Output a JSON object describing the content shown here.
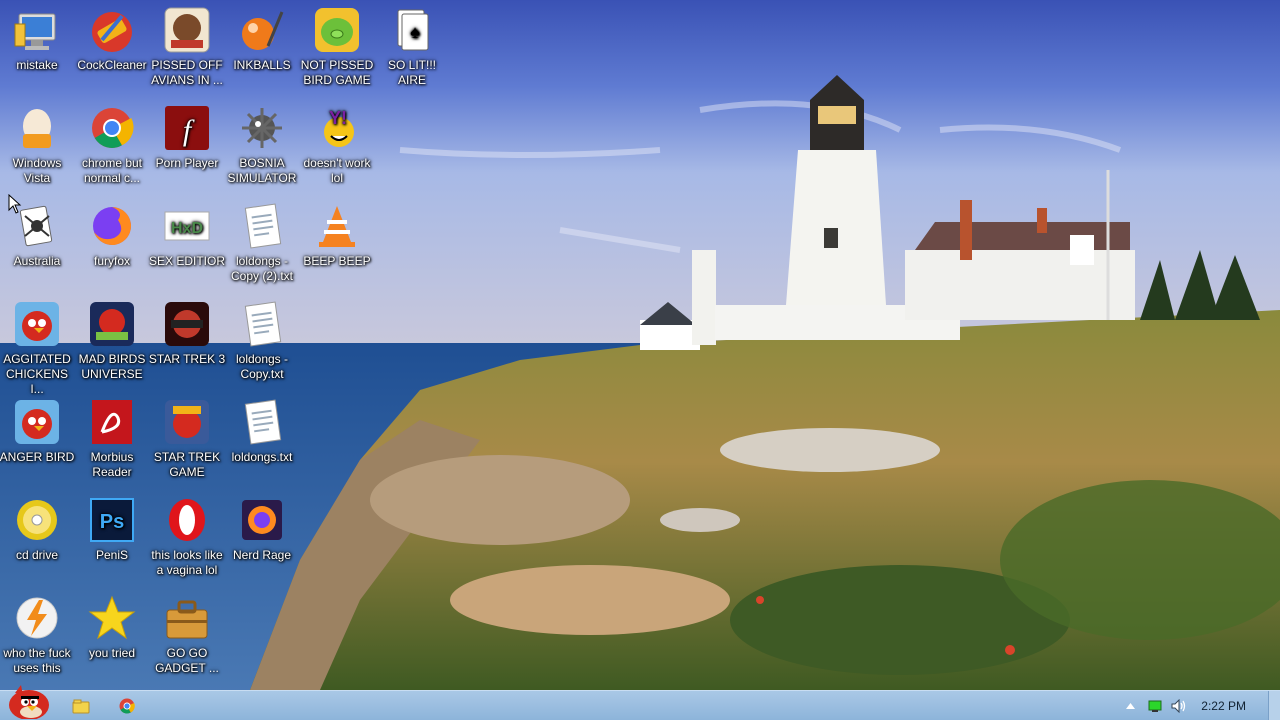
{
  "desktop": {
    "icons": [
      {
        "label": "mistake",
        "icon": "computer-icon"
      },
      {
        "label": "CockCleaner",
        "icon": "ccleaner-icon"
      },
      {
        "label": "PISSED OFF AVIANS IN ...",
        "icon": "angry-birds-seasons-icon"
      },
      {
        "label": "INKBALLS",
        "icon": "inkball-icon"
      },
      {
        "label": "NOT PISSED BIRD GAME",
        "icon": "bad-piggies-icon"
      },
      {
        "label": "SO LIT!!! AIRE",
        "icon": "solitaire-icon"
      },
      {
        "label": "Windows Vista",
        "icon": "egg-icon"
      },
      {
        "label": "chrome but normal c...",
        "icon": "chrome-icon"
      },
      {
        "label": "Porn Player",
        "icon": "flash-player-icon"
      },
      {
        "label": "BOSNIA SIMULATOR",
        "icon": "minesweeper-icon"
      },
      {
        "label": "doesn't work lol",
        "icon": "yahoo-messenger-icon"
      },
      {
        "label": "Australia",
        "icon": "spider-solitaire-icon"
      },
      {
        "label": "furyfox",
        "icon": "firefox-icon"
      },
      {
        "label": "SEX EDITIOR",
        "icon": "hxd-editor-icon"
      },
      {
        "label": "loldongs - Copy (2).txt",
        "icon": "text-file-icon"
      },
      {
        "label": "BEEP BEEP",
        "icon": "vlc-icon"
      },
      {
        "label": "AGGITATED CHICKENS I...",
        "icon": "angry-birds-icon"
      },
      {
        "label": "MAD BIRDS UNIVERSE",
        "icon": "angry-birds-space-icon"
      },
      {
        "label": "STAR TREK 3",
        "icon": "angry-birds-star-wars-2-icon"
      },
      {
        "label": "loldongs - Copy.txt",
        "icon": "text-file-icon"
      },
      {
        "label": "ANGER BIRD",
        "icon": "angry-birds-icon"
      },
      {
        "label": "Morbius Reader",
        "icon": "adobe-reader-icon"
      },
      {
        "label": "STAR TREK GAME",
        "icon": "angry-birds-star-wars-icon"
      },
      {
        "label": "loldongs.txt",
        "icon": "text-file-icon"
      },
      {
        "label": "cd drive",
        "icon": "cd-drive-icon"
      },
      {
        "label": "PeniS",
        "icon": "photoshop-icon"
      },
      {
        "label": "this looks like a vagina lol",
        "icon": "opera-icon"
      },
      {
        "label": "Nerd Rage",
        "icon": "firefox-nightly-icon"
      },
      {
        "label": "who the fuck uses this",
        "icon": "winamp-icon"
      },
      {
        "label": "you tried",
        "icon": "star-icon"
      },
      {
        "label": "GO GO GADGET ...",
        "icon": "briefcase-icon"
      }
    ]
  },
  "taskbar": {
    "start_icon": "angry-bird-start-icon",
    "pinned": [
      {
        "icon": "file-explorer-icon"
      },
      {
        "icon": "chrome-icon"
      }
    ],
    "tray_icons": [
      "show-hidden-icon",
      "network-icon",
      "volume-icon"
    ],
    "clock": "2:22 PM"
  },
  "colors": {
    "taskbar": "#9bbde0",
    "sky": "#5b76cf",
    "sea": "#3a66a6"
  }
}
